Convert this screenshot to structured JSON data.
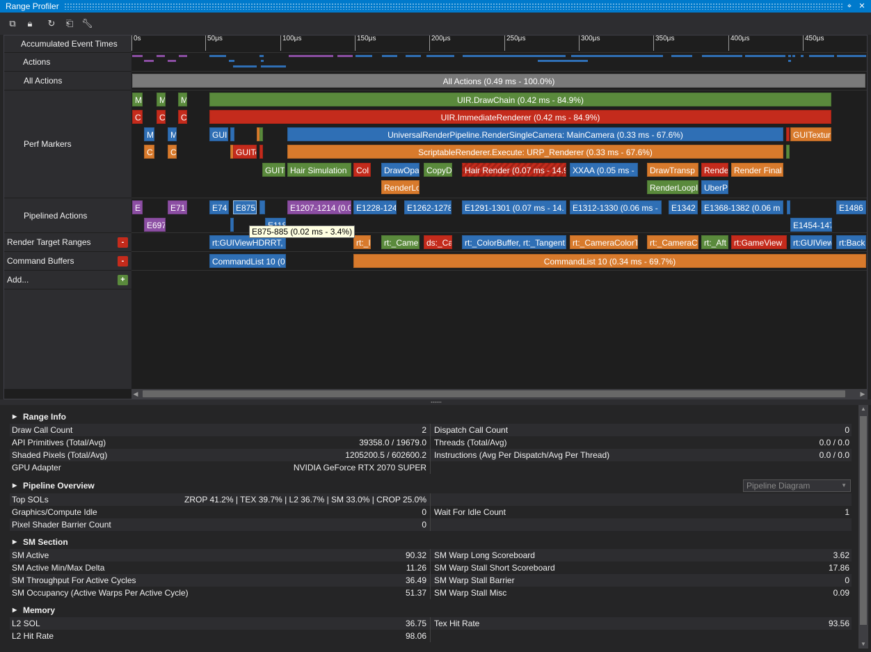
{
  "window": {
    "title": "Range Profiler"
  },
  "toolbar": {
    "icons": [
      "copy-icon",
      "lock-icon",
      "refresh-icon",
      "export-icon",
      "wrench-icon"
    ]
  },
  "ruler": {
    "label": "Accumulated Event Times",
    "ticks": [
      "0s",
      "50μs",
      "100μs",
      "150μs",
      "200μs",
      "250μs",
      "300μs",
      "350μs",
      "400μs",
      "450μs"
    ]
  },
  "rows": {
    "actions": "Actions",
    "all_actions": "All Actions",
    "perf_markers": "Perf Markers",
    "pipelined_actions": "Pipelined Actions",
    "render_target_ranges": "Render Target Ranges",
    "command_buffers": "Command Buffers",
    "add": "Add..."
  },
  "buttons": {
    "remove": "-",
    "add": "+"
  },
  "all_actions_bar": "All Actions (0.49 ms - 100.0%)",
  "perf_markers": {
    "row1": [
      "M",
      "M",
      "M",
      "UIR.DrawChain (0.42 ms - 84.9%)"
    ],
    "row2": [
      "C",
      "C",
      "C",
      "UIR.ImmediateRenderer (0.42 ms - 84.9%)"
    ],
    "row3": [
      "M",
      "M",
      "GUI",
      "UniversalRenderPipeline.RenderSingleCamera: MainCamera (0.33 ms - 67.6%)",
      "GUITextur"
    ],
    "row4": [
      "C",
      "C",
      "GUITe",
      "ScriptableRenderer.Execute: URP_Renderer (0.33 ms - 67.6%)"
    ],
    "row5": [
      "GUITe",
      "Hair Simulation",
      "Col",
      "DrawOpa",
      "CopyD",
      "Hair Render (0.07 ms - 14.9",
      "XXAA (0.05 ms -",
      "DrawTransp",
      "Rende",
      "Render Final"
    ],
    "row6": [
      "RenderLo",
      "RenderLoopI",
      "UberP"
    ]
  },
  "pipelined": {
    "row1": [
      "E",
      "E71",
      "E74",
      "E875",
      "E1207-1214 (0.0",
      "E1228-124",
      "E1262-1278",
      "E1291-1301 (0.07 ms - 14.",
      "E1312-1330 (0.06 ms -",
      "E1342",
      "E1368-1382 (0.06 m",
      "E1486"
    ],
    "row2": [
      "E697",
      "E118",
      "E1454-147"
    ]
  },
  "tooltip": "E875-885 (0.02 ms - 3.4%)",
  "render_targets": [
    "rt:GUIViewHDRRT, d",
    "rt:_I",
    "rt:_Came",
    "ds:_Ca",
    "rt:_ColorBuffer, rt:_TangentB",
    "rt:_CameraColorT",
    "rt:_CameraC",
    "rt:_Aft",
    "rt:GameView",
    "rt:GUIView",
    "rt:Back"
  ],
  "command_buffers": [
    "CommandList 10 (0.",
    "CommandList 10 (0.34 ms - 69.7%)"
  ],
  "range_info": {
    "title": "Range Info",
    "rows": [
      {
        "k": "Draw Call Count",
        "v": "2",
        "k2": "Dispatch Call Count",
        "v2": "0"
      },
      {
        "k": "API Primitives (Total/Avg)",
        "v": "39358.0 / 19679.0",
        "k2": "Threads (Total/Avg)",
        "v2": "0.0 / 0.0"
      },
      {
        "k": "Shaded Pixels (Total/Avg)",
        "v": "1205200.5 / 602600.2",
        "k2": "Instructions (Avg Per Dispatch/Avg Per Thread)",
        "v2": "0.0 / 0.0"
      },
      {
        "k": "GPU Adapter",
        "v": "NVIDIA GeForce RTX 2070 SUPER",
        "k2": "",
        "v2": ""
      }
    ]
  },
  "pipeline_overview": {
    "title": "Pipeline Overview",
    "dropdown": "Pipeline Diagram",
    "rows": [
      {
        "k": "Top SOLs",
        "v": "ZROP 41.2% | TEX 39.7% | L2 36.7% | SM 33.0% | CROP 25.0%",
        "k2": "",
        "v2": ""
      },
      {
        "k": "Graphics/Compute Idle",
        "v": "0",
        "k2": "Wait For Idle Count",
        "v2": "1"
      },
      {
        "k": "Pixel Shader Barrier Count",
        "v": "0",
        "k2": "",
        "v2": ""
      }
    ]
  },
  "sm_section": {
    "title": "SM Section",
    "rows": [
      {
        "k": "SM Active",
        "v": "90.32",
        "k2": "SM Warp Long Scoreboard",
        "v2": "3.62"
      },
      {
        "k": "SM Active Min/Max Delta",
        "v": "11.26",
        "k2": "SM Warp Stall Short Scoreboard",
        "v2": "17.86"
      },
      {
        "k": "SM Throughput For Active Cycles",
        "v": "36.49",
        "k2": "SM Warp Stall Barrier",
        "v2": "0"
      },
      {
        "k": "SM Occupancy (Active Warps Per Active Cycle)",
        "v": "51.37",
        "k2": "SM Warp Stall Misc",
        "v2": "0.09"
      }
    ]
  },
  "memory": {
    "title": "Memory",
    "rows": [
      {
        "k": "L2 SOL",
        "v": "36.75",
        "k2": "Tex Hit Rate",
        "v2": "93.56"
      },
      {
        "k": "L2 Hit Rate",
        "v": "98.06",
        "k2": "",
        "v2": ""
      }
    ]
  },
  "colors": {
    "accent": "#007acc",
    "green": "#5a8a3c",
    "red": "#c42b1c",
    "blue": "#2f6fb5",
    "orange": "#d87a2c",
    "purple": "#8c4ea3"
  }
}
